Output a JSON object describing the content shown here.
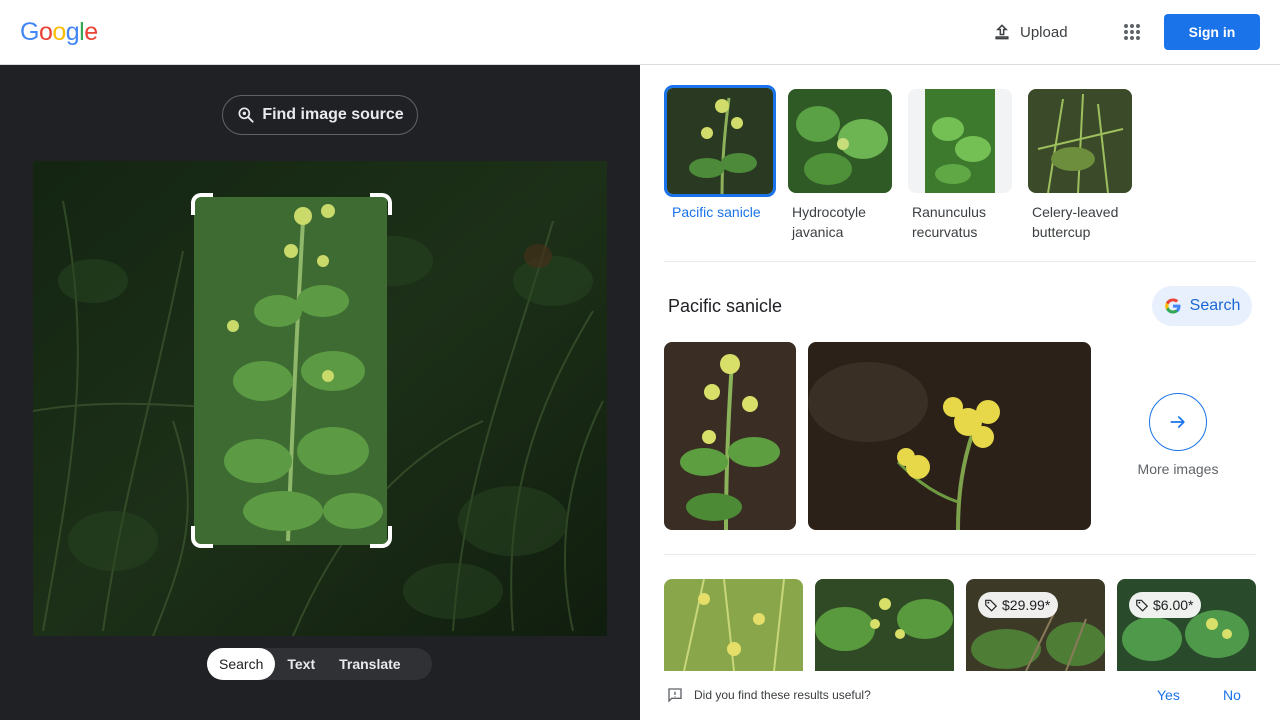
{
  "header": {
    "logo_letters": [
      {
        "ch": "G",
        "color": "#4285F4"
      },
      {
        "ch": "o",
        "color": "#EA4335"
      },
      {
        "ch": "o",
        "color": "#FBBC05"
      },
      {
        "ch": "g",
        "color": "#4285F4"
      },
      {
        "ch": "l",
        "color": "#34A853"
      },
      {
        "ch": "e",
        "color": "#EA4335"
      }
    ],
    "upload_label": "Upload",
    "upload_icon": "upload-icon",
    "apps_icon": "apps-grid-icon",
    "signin_label": "Sign in"
  },
  "lens": {
    "find_source_label": "Find image source",
    "modes": [
      {
        "label": "Search",
        "active": true
      },
      {
        "label": "Text",
        "active": false
      },
      {
        "label": "Translate",
        "active": false
      }
    ]
  },
  "matches": [
    {
      "label": "Pacific sanicle",
      "selected": true
    },
    {
      "label": "Hydrocotyle javanica",
      "selected": false
    },
    {
      "label": "Ranunculus recurvatus",
      "selected": false
    },
    {
      "label": "Celery-leaved buttercup",
      "selected": false
    }
  ],
  "entity": {
    "title": "Pacific sanicle",
    "search_label": "Search",
    "more_images_label": "More images"
  },
  "results": {
    "prices": [
      "",
      "",
      "$29.99*",
      "$6.00*"
    ]
  },
  "feedback": {
    "question": "Did you find these results useful?",
    "yes": "Yes",
    "no": "No"
  },
  "colors": {
    "accent": "#1a73e8",
    "dark_panel": "#202124"
  }
}
